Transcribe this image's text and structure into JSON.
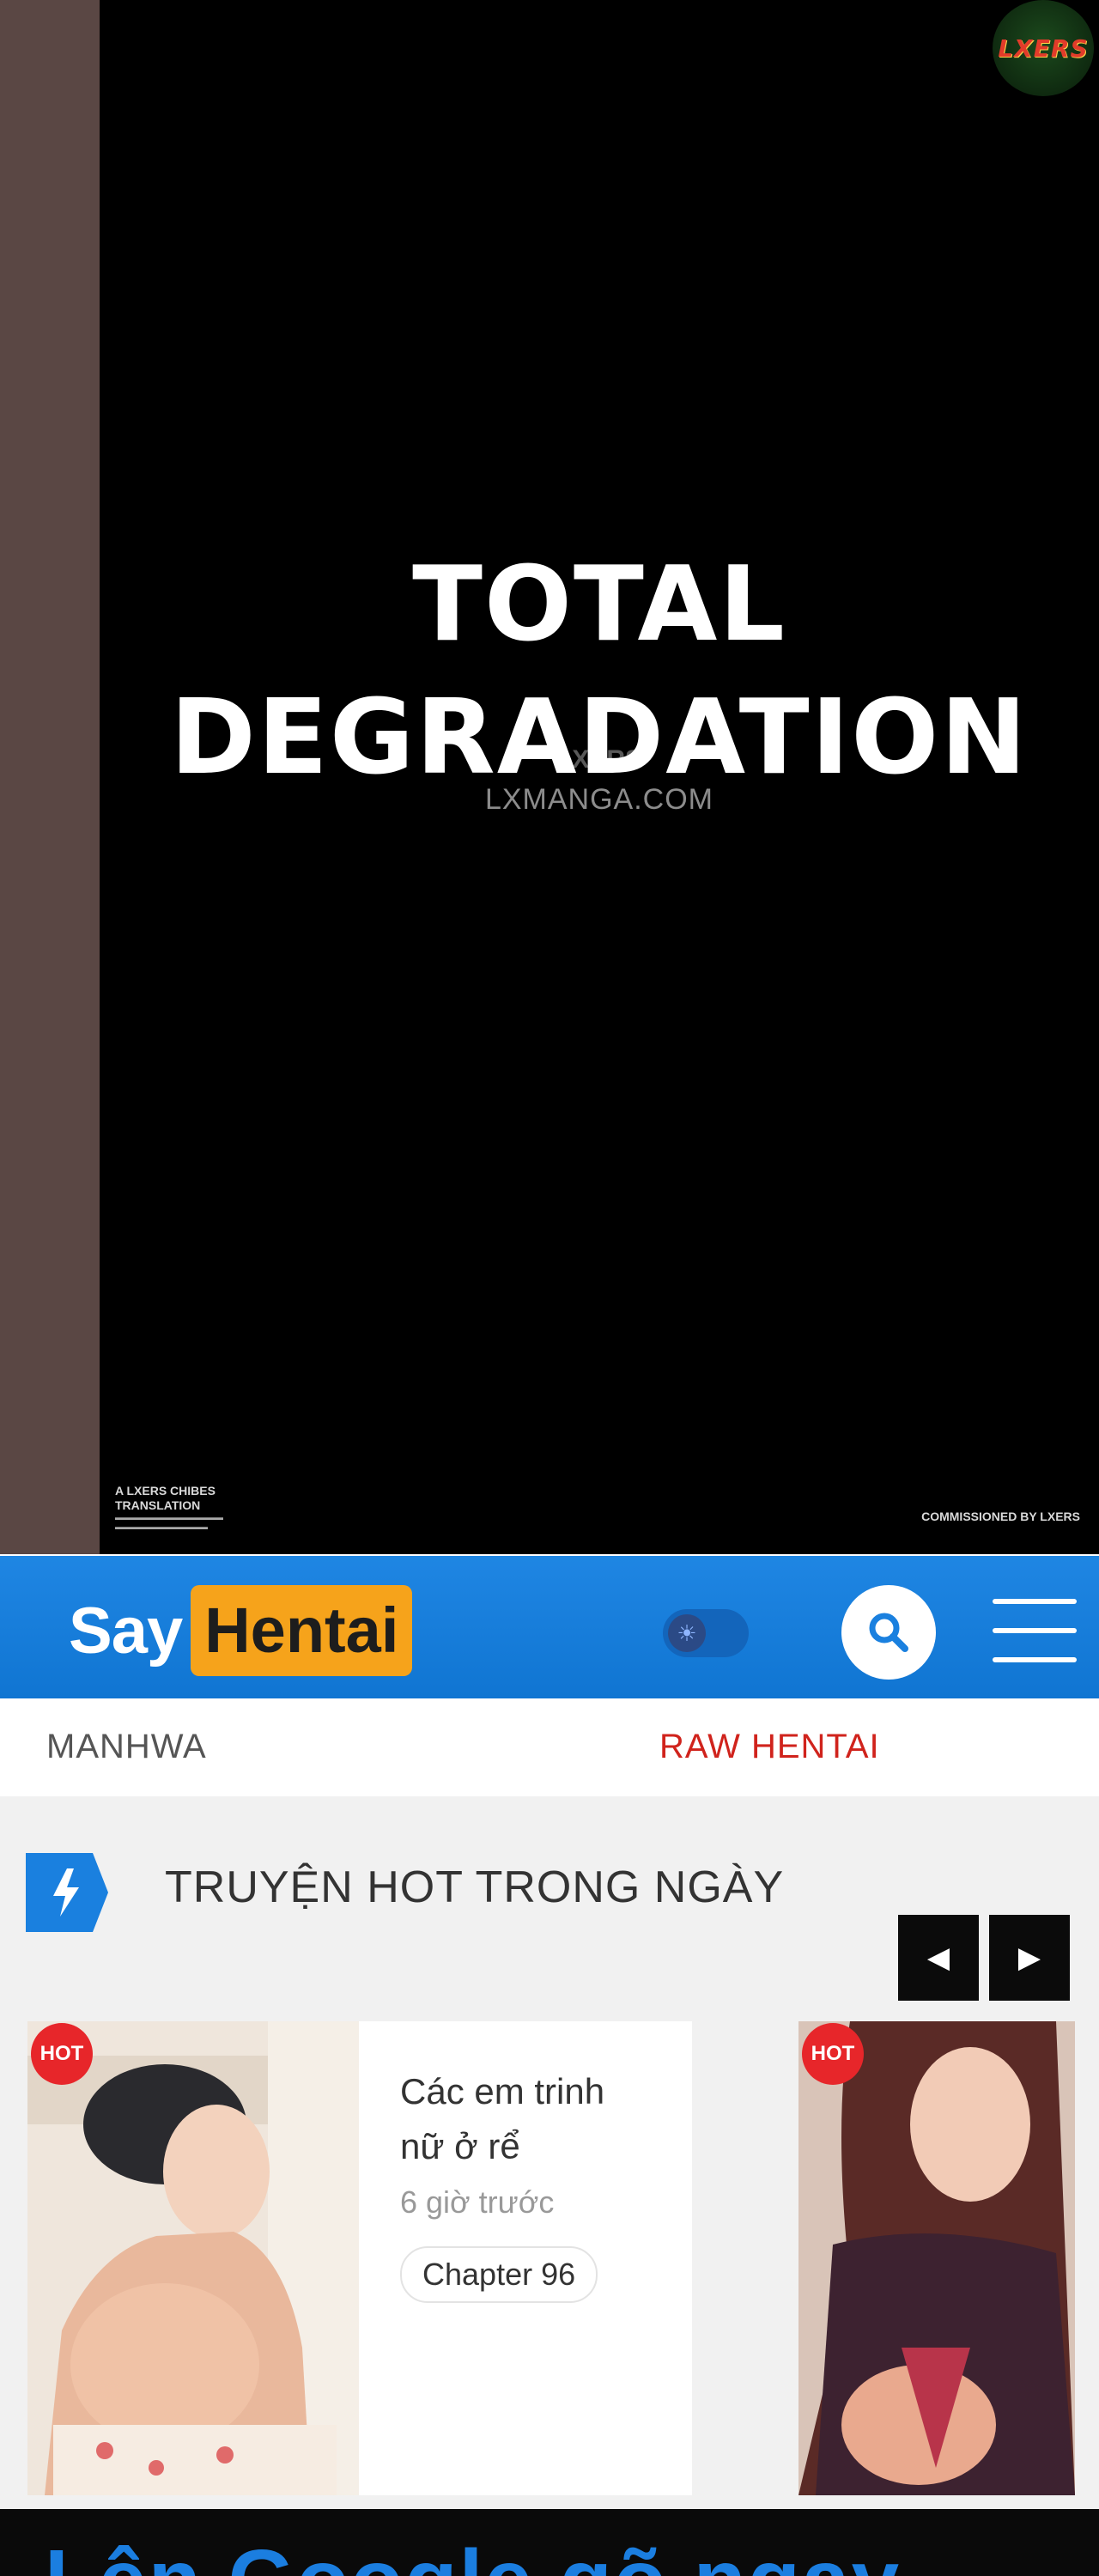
{
  "panel": {
    "title_line_1": "TOTAL",
    "title_line_2": "DEGRADATION",
    "watermark_small": "LXERS",
    "watermark_site": "LXMANGA.COM",
    "logo_text": "LXERS",
    "credit_left_title": "A LXERS CHIBES TRANSLATION",
    "credit_right": "COMMISSIONED BY LXERS"
  },
  "header": {
    "logo_say": "Say",
    "logo_hentai": "Hentai",
    "toggle_icon": "sun-icon",
    "search_icon": "search-icon",
    "menu_icon": "hamburger-icon",
    "accent_color": "#1a80df",
    "brand_color": "#f6a31b"
  },
  "subnav": {
    "manhwa": "MANHWA",
    "raw": "RAW HENTAI"
  },
  "hot": {
    "title": "TRUYỆN HOT TRONG NGÀY",
    "prev_icon": "chevron-left-icon",
    "next_icon": "chevron-right-icon",
    "items": [
      {
        "badge": "HOT",
        "title": "Các em trinh nữ ở rể",
        "time": "6 giờ trước",
        "chapter": "Chapter 96"
      },
      {
        "badge": "HOT"
      }
    ]
  },
  "banner": {
    "text": "Lên Google gõ ngay"
  }
}
